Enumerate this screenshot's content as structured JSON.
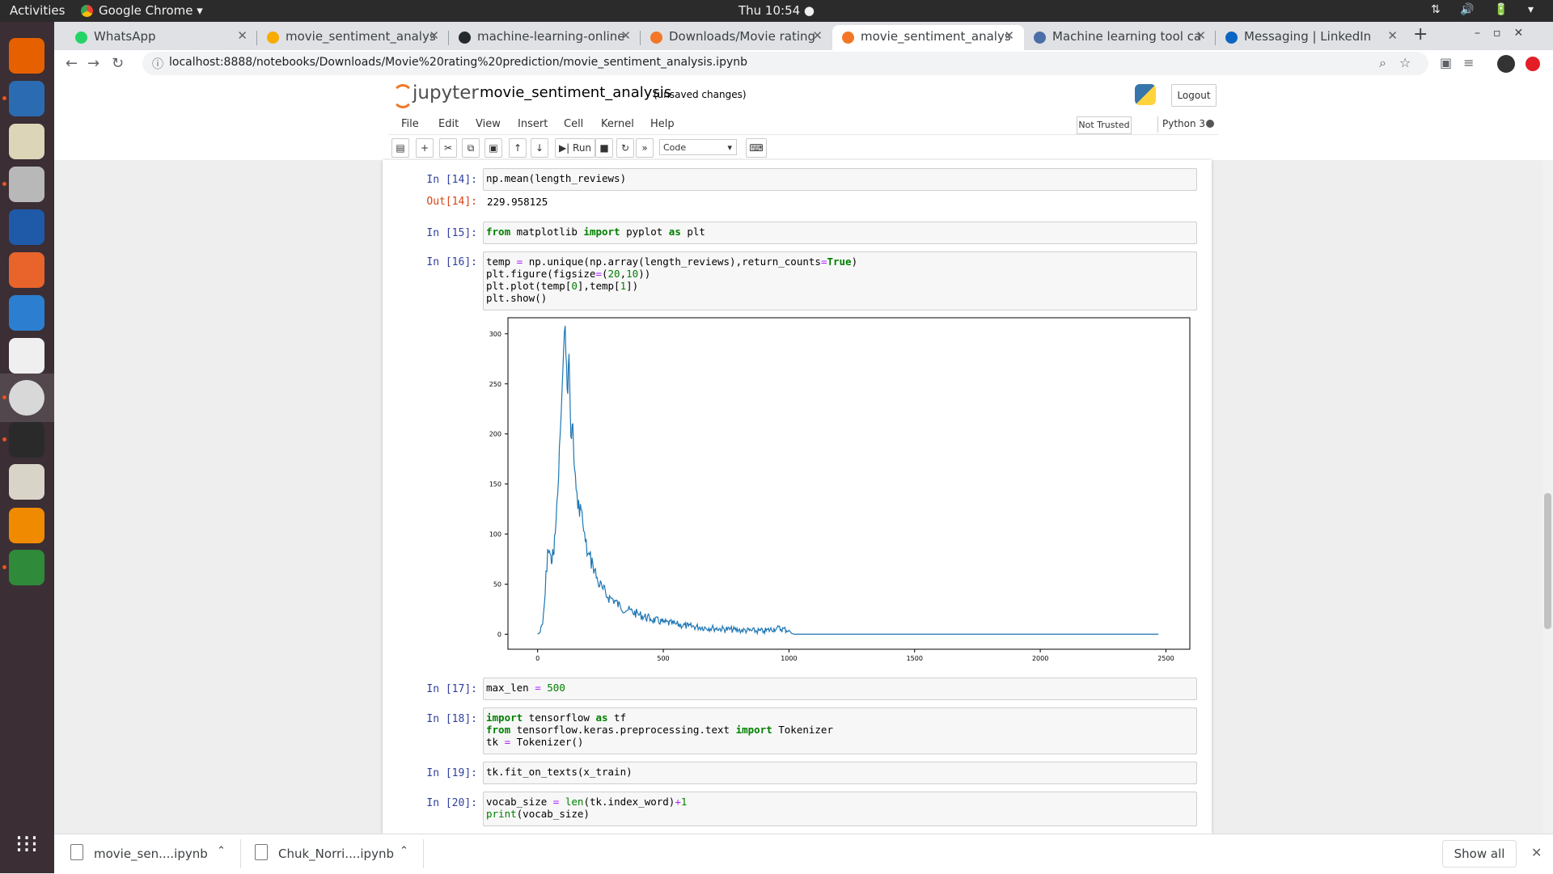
{
  "topbar": {
    "activities": "Activities",
    "app_name": "Google Chrome ▾",
    "clock": "Thu 10:54 ●",
    "tray": "⇅ 🔊 🔋 ▾"
  },
  "dock": {
    "icons": [
      "firefox-icon",
      "thunderbird-icon",
      "rhythmbox-icon",
      "files-icon",
      "writer-icon",
      "software-icon",
      "help-icon",
      "amazon-icon",
      "chrome-icon",
      "terminal-icon",
      "settings-icon",
      "vlc-icon",
      "calc-icon"
    ],
    "colors": [
      "#e66000",
      "#2a6bb2",
      "#ddd5b8",
      "#b8b8b8",
      "#1e5aa8",
      "#e9642a",
      "#2c7fd0",
      "#efefef",
      "#d8d8d8",
      "#2a2a2a",
      "#d9d4c8",
      "#f08a00",
      "#2f8a3a"
    ]
  },
  "tabs": [
    {
      "title": "WhatsApp",
      "icon_color": "#25d366"
    },
    {
      "title": "movie_sentiment_analysis",
      "icon_color": "#f9ab00"
    },
    {
      "title": "machine-learning-online",
      "icon_color": "#24292e"
    },
    {
      "title": "Downloads/Movie rating",
      "icon_color": "#f37726"
    },
    {
      "title": "movie_sentiment_analysis",
      "icon_color": "#f37726"
    },
    {
      "title": "Machine learning tool car",
      "icon_color": "#4b6ea8"
    },
    {
      "title": "Messaging | LinkedIn",
      "icon_color": "#0a66c2"
    }
  ],
  "address": {
    "url": "localhost:8888/notebooks/Downloads/Movie%20rating%20prediction/movie_sentiment_analysis.ipynb"
  },
  "jupyter": {
    "logo_text": "jupyter",
    "notebook_name": "movie_sentiment_analysis",
    "save_status": "(unsaved changes)",
    "logout": "Logout",
    "menus": [
      "File",
      "Edit",
      "View",
      "Insert",
      "Cell",
      "Kernel",
      "Help"
    ],
    "trusted": "Not Trusted",
    "kernel": "Python 3",
    "toolbar": {
      "run": "▶| Run",
      "cell_type": "Code"
    }
  },
  "cells": {
    "c14": {
      "in": "In [14]:",
      "out": "Out[14]:",
      "code": "np.mean(length_reviews)",
      "output": "229.958125"
    },
    "c15": {
      "in": "In [15]:"
    },
    "c16": {
      "in": "In [16]:"
    },
    "c17": {
      "in": "In [17]:"
    },
    "c18": {
      "in": "In [18]:"
    },
    "c19": {
      "in": "In [19]:",
      "code": "tk.fit_on_texts(x_train)"
    },
    "c20": {
      "in": "In [20]:"
    }
  },
  "chart_data": {
    "type": "line",
    "title": "",
    "xlabel": "",
    "ylabel": "",
    "xlim": [
      -118,
      2595
    ],
    "ylim": [
      -15,
      316
    ],
    "x_ticks": [
      0,
      500,
      1000,
      1500,
      2000,
      2500
    ],
    "y_ticks": [
      0,
      50,
      100,
      150,
      200,
      250,
      300
    ],
    "color": "#1f77b4",
    "series": [
      {
        "x": [
          0,
          10,
          20,
          30,
          40,
          50,
          55,
          60,
          65,
          70,
          80,
          90,
          100,
          110,
          115,
          120,
          125,
          130,
          135,
          140,
          145,
          150,
          160,
          170,
          180,
          190,
          200,
          220,
          240,
          260,
          280,
          300,
          330,
          360,
          400,
          450,
          500,
          550,
          600,
          700,
          800,
          900,
          950,
          1000,
          1010,
          1020,
          1100,
          1500,
          2000,
          2300,
          2470
        ],
        "y": [
          0,
          2,
          10,
          40,
          85,
          80,
          70,
          85,
          80,
          100,
          140,
          200,
          260,
          308,
          270,
          240,
          280,
          220,
          195,
          210,
          170,
          160,
          125,
          130,
          110,
          92,
          80,
          70,
          52,
          45,
          37,
          35,
          27,
          24,
          20,
          15,
          12,
          10,
          8,
          6,
          4,
          3,
          6,
          4,
          1,
          0,
          0,
          0,
          0,
          0,
          0
        ]
      }
    ]
  },
  "downloads": {
    "items": [
      "movie_sen....ipynb",
      "Chuk_Norri....ipynb"
    ],
    "show_all": "Show all"
  }
}
